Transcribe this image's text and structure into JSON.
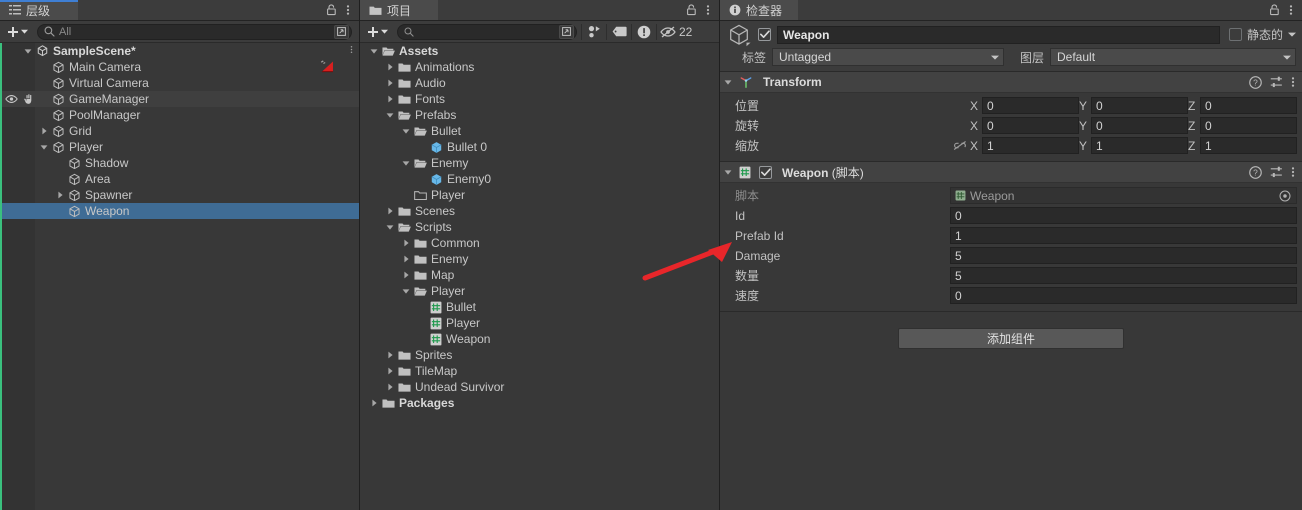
{
  "hierarchy": {
    "tab_label": "层级",
    "tab_icon": "hierarchy-icon",
    "search_placeholder": "All",
    "create_label": "+",
    "items": [
      {
        "label": "SampleScene*",
        "depth": 0,
        "expanded": true,
        "bold": true,
        "icon": "unity-scene-icon",
        "state": "scene",
        "kebab": true
      },
      {
        "label": "Main Camera",
        "depth": 1,
        "expanded": null,
        "bold": false,
        "icon": "gameobject-icon",
        "state": "normal",
        "badge": "camera-preview-badge"
      },
      {
        "label": "Virtual Camera",
        "depth": 1,
        "expanded": null,
        "bold": false,
        "icon": "gameobject-icon",
        "state": "normal"
      },
      {
        "label": "GameManager",
        "depth": 1,
        "expanded": null,
        "bold": false,
        "icon": "gameobject-icon",
        "state": "hover",
        "vis": true
      },
      {
        "label": "PoolManager",
        "depth": 1,
        "expanded": null,
        "bold": false,
        "icon": "gameobject-icon",
        "state": "normal"
      },
      {
        "label": "Grid",
        "depth": 1,
        "expanded": false,
        "bold": false,
        "icon": "gameobject-icon",
        "state": "normal"
      },
      {
        "label": "Player",
        "depth": 1,
        "expanded": true,
        "bold": false,
        "icon": "gameobject-icon",
        "state": "normal"
      },
      {
        "label": "Shadow",
        "depth": 2,
        "expanded": null,
        "bold": false,
        "icon": "gameobject-icon",
        "state": "normal"
      },
      {
        "label": "Area",
        "depth": 2,
        "expanded": null,
        "bold": false,
        "icon": "gameobject-icon",
        "state": "normal"
      },
      {
        "label": "Spawner",
        "depth": 2,
        "expanded": false,
        "bold": false,
        "icon": "gameobject-icon",
        "state": "normal"
      },
      {
        "label": "Weapon",
        "depth": 2,
        "expanded": null,
        "bold": false,
        "icon": "gameobject-icon",
        "state": "selected"
      }
    ]
  },
  "project": {
    "tab_label": "项目",
    "tab_icon": "folder-icon",
    "search_placeholder": "",
    "create_label": "+",
    "toolbar_icons": [
      "favorite-filter-icon",
      "label-filter-icon",
      "error-filter-icon",
      "hidden-packages-icon"
    ],
    "hidden_count": "22",
    "items": [
      {
        "label": "Assets",
        "depth": 0,
        "expanded": true,
        "bold": true,
        "icon": "folder-open-icon"
      },
      {
        "label": "Animations",
        "depth": 1,
        "expanded": false,
        "bold": false,
        "icon": "folder-icon"
      },
      {
        "label": "Audio",
        "depth": 1,
        "expanded": false,
        "bold": false,
        "icon": "folder-icon"
      },
      {
        "label": "Fonts",
        "depth": 1,
        "expanded": false,
        "bold": false,
        "icon": "folder-icon"
      },
      {
        "label": "Prefabs",
        "depth": 1,
        "expanded": true,
        "bold": false,
        "icon": "folder-open-icon"
      },
      {
        "label": "Bullet",
        "depth": 2,
        "expanded": true,
        "bold": false,
        "icon": "folder-open-icon"
      },
      {
        "label": "Bullet 0",
        "depth": 3,
        "expanded": null,
        "bold": false,
        "icon": "prefab-icon"
      },
      {
        "label": "Enemy",
        "depth": 2,
        "expanded": true,
        "bold": false,
        "icon": "folder-open-icon"
      },
      {
        "label": "Enemy0",
        "depth": 3,
        "expanded": null,
        "bold": false,
        "icon": "prefab-icon"
      },
      {
        "label": "Player",
        "depth": 2,
        "expanded": null,
        "bold": false,
        "icon": "folder-empty-icon"
      },
      {
        "label": "Scenes",
        "depth": 1,
        "expanded": false,
        "bold": false,
        "icon": "folder-icon"
      },
      {
        "label": "Scripts",
        "depth": 1,
        "expanded": true,
        "bold": false,
        "icon": "folder-open-icon"
      },
      {
        "label": "Common",
        "depth": 2,
        "expanded": false,
        "bold": false,
        "icon": "folder-icon"
      },
      {
        "label": "Enemy",
        "depth": 2,
        "expanded": false,
        "bold": false,
        "icon": "folder-icon"
      },
      {
        "label": "Map",
        "depth": 2,
        "expanded": false,
        "bold": false,
        "icon": "folder-icon"
      },
      {
        "label": "Player",
        "depth": 2,
        "expanded": true,
        "bold": false,
        "icon": "folder-open-icon"
      },
      {
        "label": "Bullet",
        "depth": 3,
        "expanded": null,
        "bold": false,
        "icon": "csharp-script-icon"
      },
      {
        "label": "Player",
        "depth": 3,
        "expanded": null,
        "bold": false,
        "icon": "csharp-script-icon"
      },
      {
        "label": "Weapon",
        "depth": 3,
        "expanded": null,
        "bold": false,
        "icon": "csharp-script-icon"
      },
      {
        "label": "Sprites",
        "depth": 1,
        "expanded": false,
        "bold": false,
        "icon": "folder-icon"
      },
      {
        "label": "TileMap",
        "depth": 1,
        "expanded": false,
        "bold": false,
        "icon": "folder-icon"
      },
      {
        "label": "Undead Survivor",
        "depth": 1,
        "expanded": false,
        "bold": false,
        "icon": "folder-icon"
      },
      {
        "label": "Packages",
        "depth": 0,
        "expanded": false,
        "bold": true,
        "icon": "folder-icon"
      }
    ]
  },
  "inspector": {
    "tab_label": "检查器",
    "tab_icon": "info-icon",
    "object": {
      "enabled": true,
      "name": "Weapon",
      "static_label": "静态的",
      "static_checked": false,
      "tag_label": "标签",
      "tag_value": "Untagged",
      "layer_label": "图层",
      "layer_value": "Default"
    },
    "components": [
      {
        "title": "Transform",
        "subtitle": "",
        "icon": "transform-icon",
        "has_checkbox": false,
        "expanded": true,
        "rows": [
          {
            "label": "位置",
            "type": "vector3",
            "link": false,
            "x": "0",
            "y": "0",
            "z": "0"
          },
          {
            "label": "旋转",
            "type": "vector3",
            "link": false,
            "x": "0",
            "y": "0",
            "z": "0"
          },
          {
            "label": "缩放",
            "type": "vector3",
            "link": true,
            "x": "1",
            "y": "1",
            "z": "1"
          }
        ]
      },
      {
        "title": "Weapon",
        "subtitle": "(脚本)",
        "icon": "csharp-script-icon",
        "has_checkbox": true,
        "checked": true,
        "expanded": true,
        "rows": [
          {
            "label": "脚本",
            "type": "object",
            "value": "Weapon",
            "readonly": true
          },
          {
            "label": "Id",
            "type": "field",
            "value": "0"
          },
          {
            "label": "Prefab Id",
            "type": "field",
            "value": "1"
          },
          {
            "label": "Damage",
            "type": "field",
            "value": "5"
          },
          {
            "label": "数量",
            "type": "field",
            "value": "5"
          },
          {
            "label": "速度",
            "type": "field",
            "value": "0"
          }
        ]
      }
    ],
    "add_component_label": "添加组件"
  },
  "annotation": {
    "type": "red-arrow",
    "color": "#e8262a"
  },
  "colors": {
    "window_bg": "#383838",
    "tab_bg": "#3c3c3c",
    "tab_active": "#4b4b4b",
    "tab_accent": "#3f7fd4",
    "selection": "#2c5d87",
    "field_bg": "#2a2a2a",
    "component_header": "#424242",
    "hier_accent": "#3ac07e"
  }
}
